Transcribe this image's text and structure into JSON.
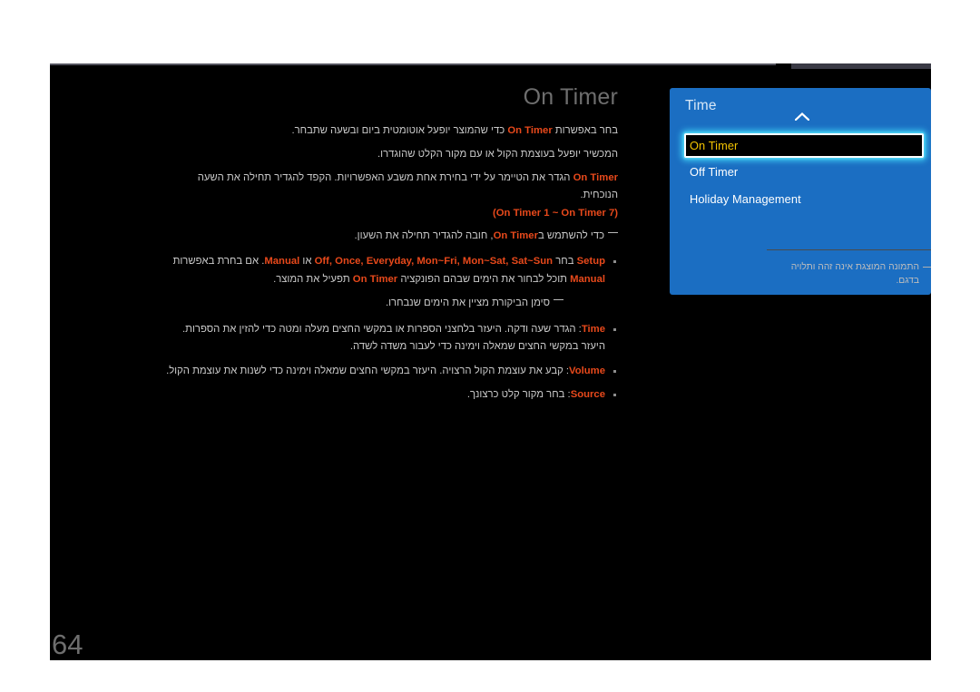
{
  "document": {
    "page_number": "64",
    "title": "On Timer"
  },
  "body": {
    "paragraphs": [
      {
        "id": "p1",
        "segments": [
          {
            "text": "בחר באפשרות ",
            "kw": false
          },
          {
            "text": "On Timer",
            "kw": true
          },
          {
            "text": " כדי שהמוצר יופעל אוטומטית ביום ובשעה שתבחר.",
            "kw": false
          }
        ]
      },
      {
        "id": "p2",
        "segments": [
          {
            "text": "המכשיר יופעל בעוצמת הקול או עם מקור הקלט שהוגדרו.",
            "kw": false
          }
        ]
      },
      {
        "id": "p3",
        "segments": [
          {
            "text": "On Timer",
            "kw": true
          },
          {
            "text": " הגדר את הטיימר על ידי בחירת אחת משבע האפשרויות. הקפד להגדיר תחילה את השעה הנוכחית.",
            "kw": false
          }
        ]
      }
    ],
    "range_line": "(On Timer 1 ~ On Timer 7)",
    "clock_note": {
      "prefix": "כדי להשתמש ב",
      "keyword": "On Timer",
      "suffix": ", חובה להגדיר תחילה את השעון."
    },
    "bullets": [
      {
        "name": "setup",
        "keyword": "Setup",
        "text_before": " בחר ",
        "options": "Off, Once, Everyday, Mon~Fri, Mon~Sat, Sat~Sun",
        "text_mid": " או ",
        "manual": "Manual",
        "text_after": ". אם בחרת באפשרות ",
        "manual2": "Manual",
        "tail": " תוכל לבחור את הימים שבהם הפונקציה ",
        "keyword2": "On Timer",
        "tail2": " תפעיל את המוצר."
      },
      {
        "name": "time",
        "keyword": "Time",
        "text": ": הגדר שעה ודקה. היעזר בלחצני הספרות או במקשי החצים מעלה ומטה כדי להזין את הספרות. היעזר במקשי החצים שמאלה וימינה כדי לעבור משדה לשדה."
      },
      {
        "name": "volume",
        "keyword": "Volume",
        "text": ": קבע את עוצמת הקול הרצויה. היעזר במקשי החצים שמאלה וימינה כדי לשנות את עוצמת הקול."
      },
      {
        "name": "source",
        "keyword": "Source",
        "text": ": בחר מקור קלט כרצונך."
      }
    ],
    "checkmark_note": "סימן הביקורת מציין את הימים שנבחרו."
  },
  "osd": {
    "title": "Time",
    "scroll_up_icon": "chevron-up-icon",
    "items": [
      {
        "label": "On Timer",
        "selected": true
      },
      {
        "label": "Off Timer",
        "selected": false
      },
      {
        "label": "Holiday Management",
        "selected": false
      }
    ]
  },
  "model_note": {
    "text": "התמונה המוצגת אינה זהה ותלויה בדגם."
  },
  "colors": {
    "page_background": "#000000",
    "canvas_background": "#ffffff",
    "accent_orange": "#e8491b",
    "osd_blue": "#1b6ec2",
    "osd_selected_text": "#f2c300",
    "osd_glow": "#3fd2f5",
    "body_text": "#c9c9c9",
    "title_grey": "#6e6e6e"
  }
}
